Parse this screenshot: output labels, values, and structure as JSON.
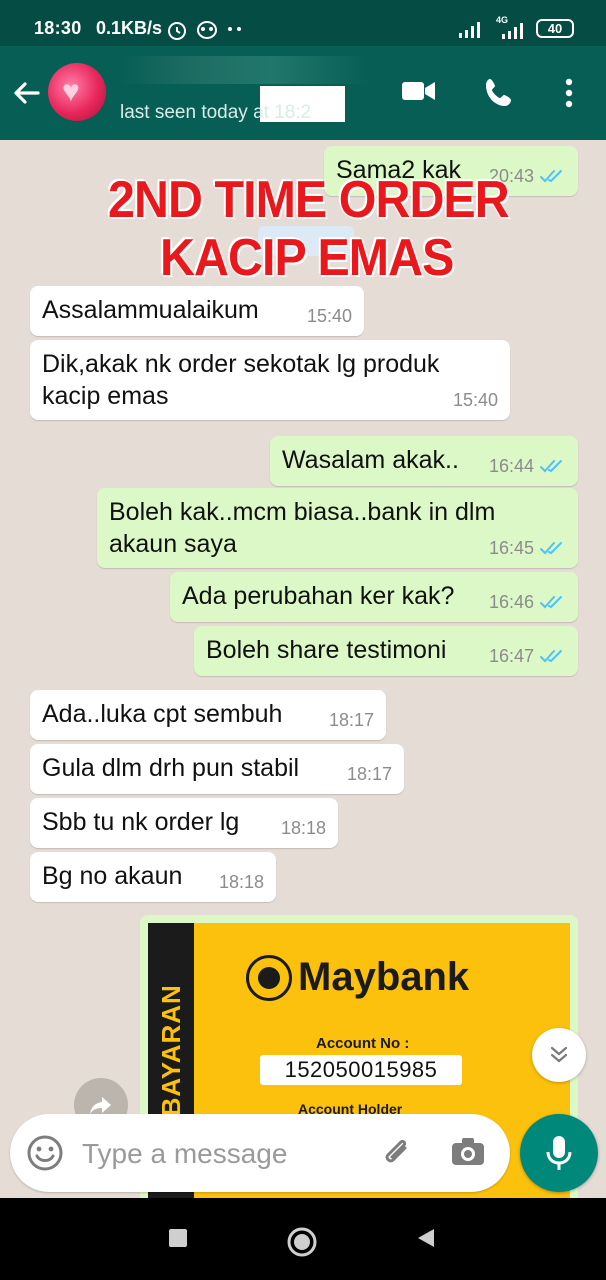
{
  "statusbar": {
    "time": "18:30",
    "net_speed": "0.1KB/s",
    "battery": "40",
    "network_type": "4G"
  },
  "header": {
    "last_seen": "last seen today at 18:2",
    "icons": [
      "back-arrow-icon",
      "video-call-icon",
      "phone-icon",
      "more-vert-icon"
    ]
  },
  "overlay": {
    "line1": "2ND TIME ORDER",
    "line2": "KACIP EMAS"
  },
  "messages": [
    {
      "dir": "out",
      "text": "Sama2 kak",
      "time": "20:43"
    },
    {
      "dir": "in",
      "text": "Assalammualaikum",
      "time": "15:40"
    },
    {
      "dir": "in",
      "text": "Dik,akak nk order sekotak lg produk kacip emas",
      "time": "15:40"
    },
    {
      "dir": "out",
      "text": "Wasalam akak..",
      "time": "16:44"
    },
    {
      "dir": "out",
      "text": "Boleh kak..mcm biasa..bank in dlm akaun  saya",
      "time": "16:45"
    },
    {
      "dir": "out",
      "text": "Ada perubahan ker kak?",
      "time": "16:46"
    },
    {
      "dir": "out",
      "text": "Boleh share testimoni",
      "time": "16:47"
    },
    {
      "dir": "in",
      "text": "Ada..luka cpt sembuh",
      "time": "18:17"
    },
    {
      "dir": "in",
      "text": "Gula dlm drh pun stabil",
      "time": "18:17"
    },
    {
      "dir": "in",
      "text": "Sbb tu nk order lg",
      "time": "18:18"
    },
    {
      "dir": "in",
      "text": "Bg no akaun",
      "time": "18:18"
    }
  ],
  "image_message": {
    "bank_name": "Maybank",
    "strip_text": "ARA BAYARAN",
    "account_label": "Account No :",
    "account_no": "152050015985",
    "account_holder": "Account Holder"
  },
  "input": {
    "placeholder": "Type a message"
  },
  "colors": {
    "header": "#075e54",
    "statusbar": "#054d44",
    "outgoing": "#dcf8c6",
    "incoming": "#ffffff",
    "tick": "#4fc3f7",
    "mic": "#00897b",
    "overlay": "#e8181c"
  }
}
